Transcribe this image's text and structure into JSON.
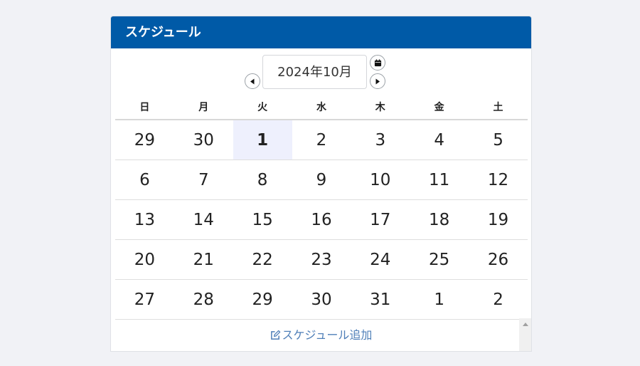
{
  "header": {
    "title": "スケジュール"
  },
  "nav": {
    "month_label": "2024年10月"
  },
  "weekdays": [
    "日",
    "月",
    "火",
    "水",
    "木",
    "金",
    "土"
  ],
  "weeks": [
    [
      "29",
      "30",
      "1",
      "2",
      "3",
      "4",
      "5"
    ],
    [
      "6",
      "7",
      "8",
      "9",
      "10",
      "11",
      "12"
    ],
    [
      "13",
      "14",
      "15",
      "16",
      "17",
      "18",
      "19"
    ],
    [
      "20",
      "21",
      "22",
      "23",
      "24",
      "25",
      "26"
    ],
    [
      "27",
      "28",
      "29",
      "30",
      "31",
      "1",
      "2"
    ]
  ],
  "today": {
    "week": 0,
    "day": 2
  },
  "footer": {
    "add_label": "スケジュール追加"
  },
  "colors": {
    "header_bg": "#005aa7",
    "sunday": "#e8141b",
    "saturday": "#1414dd",
    "today_text": "#f5a84a",
    "today_bg": "#eef0fd",
    "link": "#4f7fb8"
  },
  "icons": {
    "prev": "triangle-left-icon",
    "next": "triangle-right-icon",
    "calendar": "calendar-icon",
    "edit": "edit-icon"
  }
}
